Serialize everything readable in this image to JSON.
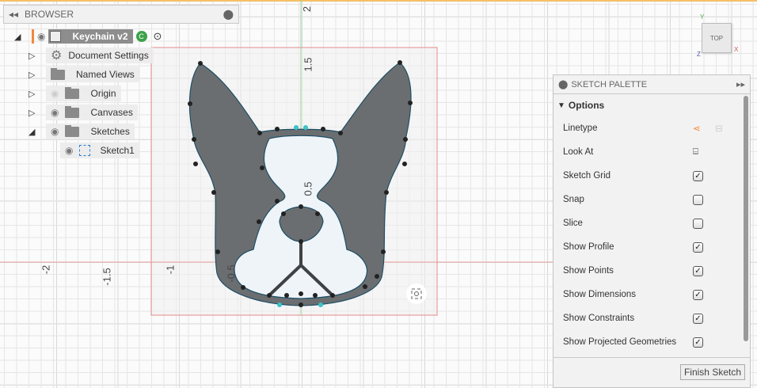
{
  "browser": {
    "title": "BROWSER",
    "component": "Keychain v2",
    "items": [
      {
        "label": "Document Settings"
      },
      {
        "label": "Named Views"
      },
      {
        "label": "Origin"
      },
      {
        "label": "Canvases"
      },
      {
        "label": "Sketches"
      },
      {
        "label": "Sketch1"
      }
    ]
  },
  "axis_labels": {
    "y2": "2",
    "y15": "1.5",
    "y05": "0.5",
    "xm2": "-2",
    "xm15": "-1.5",
    "xm1": "-1",
    "xm05": "-0.5"
  },
  "viewcube": {
    "face": "TOP",
    "x": "X",
    "y": "Y",
    "z": "Z"
  },
  "palette": {
    "title": "SKETCH PALETTE",
    "section": "Options",
    "options": [
      {
        "label": "Linetype",
        "type": "icons"
      },
      {
        "label": "Look At",
        "type": "icon"
      },
      {
        "label": "Sketch Grid",
        "checked": true
      },
      {
        "label": "Snap",
        "checked": false
      },
      {
        "label": "Slice",
        "checked": false
      },
      {
        "label": "Show Profile",
        "checked": true
      },
      {
        "label": "Show Points",
        "checked": true
      },
      {
        "label": "Show Dimensions",
        "checked": true
      },
      {
        "label": "Show Constraints",
        "checked": true
      },
      {
        "label": "Show Projected Geometries",
        "checked": true
      }
    ],
    "finish": "Finish Sketch"
  },
  "colors": {
    "accent": "#f0883e",
    "profile": "#6b6e70",
    "sketch_line": "#1f4e66",
    "highlight": "#8fd0ef",
    "active": "#3ca24a"
  }
}
